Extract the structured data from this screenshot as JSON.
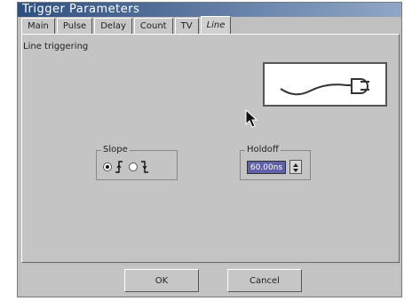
{
  "window": {
    "title": "Trigger Parameters"
  },
  "tabs": [
    {
      "label": "Main",
      "active": false
    },
    {
      "label": "Pulse",
      "active": false
    },
    {
      "label": "Delay",
      "active": false
    },
    {
      "label": "Count",
      "active": false
    },
    {
      "label": "TV",
      "active": false
    },
    {
      "label": "Line",
      "active": true
    }
  ],
  "panel": {
    "description": "Line triggering",
    "illustration_icon": "power-plug-icon"
  },
  "slope": {
    "label": "Slope",
    "options": [
      "rising",
      "falling"
    ],
    "selected": "rising"
  },
  "holdoff": {
    "label": "Holdoff",
    "value": "60.00ns"
  },
  "buttons": {
    "ok": "OK",
    "cancel": "Cancel"
  },
  "colors": {
    "title_bar": "#2f4f7f",
    "selection": "#6060a8",
    "background": "#c0c0c0"
  }
}
